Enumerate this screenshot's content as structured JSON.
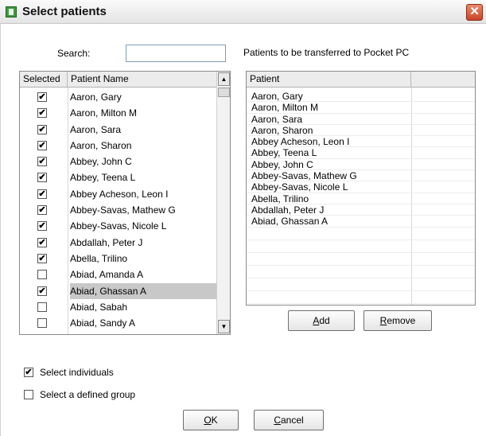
{
  "window": {
    "title": "Select patients",
    "close_glyph": "✕"
  },
  "search": {
    "label": "Search:",
    "value": "",
    "placeholder": ""
  },
  "transfer_label": "Patients to be transferred to Pocket PC",
  "left_list": {
    "columns": [
      "Selected",
      "Patient Name"
    ],
    "rows": [
      {
        "name": "Aaron, Gary",
        "checked": true
      },
      {
        "name": "Aaron, Milton M",
        "checked": true
      },
      {
        "name": "Aaron, Sara",
        "checked": true
      },
      {
        "name": "Aaron, Sharon",
        "checked": true
      },
      {
        "name": "Abbey, John C",
        "checked": true
      },
      {
        "name": "Abbey, Teena L",
        "checked": true
      },
      {
        "name": "Abbey Acheson, Leon I",
        "checked": true
      },
      {
        "name": "Abbey-Savas, Mathew G",
        "checked": true
      },
      {
        "name": "Abbey-Savas, Nicole L",
        "checked": true
      },
      {
        "name": "Abdallah, Peter J",
        "checked": true
      },
      {
        "name": "Abella, Trilino",
        "checked": true
      },
      {
        "name": "Abiad, Amanda A",
        "checked": false
      },
      {
        "name": "Abiad, Ghassan A",
        "checked": true,
        "selected": true
      },
      {
        "name": "Abiad, Sabah",
        "checked": false
      },
      {
        "name": "Abiad, Sandy A",
        "checked": false
      }
    ],
    "scroll_up_glyph": "▲",
    "scroll_down_glyph": "▼"
  },
  "right_list": {
    "columns": [
      "Patient",
      ""
    ],
    "rows": [
      "Aaron, Gary",
      "Aaron, Milton M",
      "Aaron, Sara",
      "Aaron, Sharon",
      "Abbey Acheson, Leon I",
      "Abbey, Teena L",
      "Abbey, John C",
      "Abbey-Savas, Mathew G",
      "Abbey-Savas, Nicole L",
      "Abella, Trilino",
      "Abdallah, Peter J",
      "Abiad, Ghassan A"
    ],
    "blank_rows": 7
  },
  "buttons": {
    "add_prefix": "",
    "add_key": "A",
    "add_rest": "dd",
    "remove_prefix": "",
    "remove_key": "R",
    "remove_rest": "emove",
    "ok_prefix": "",
    "ok_key": "O",
    "ok_rest": "K",
    "cancel_prefix": "",
    "cancel_key": "C",
    "cancel_rest": "ancel"
  },
  "options": {
    "individuals": {
      "label": "Select individuals",
      "checked": true
    },
    "group": {
      "label": "Select a defined group",
      "checked": false
    }
  },
  "check_glyph": "✔"
}
